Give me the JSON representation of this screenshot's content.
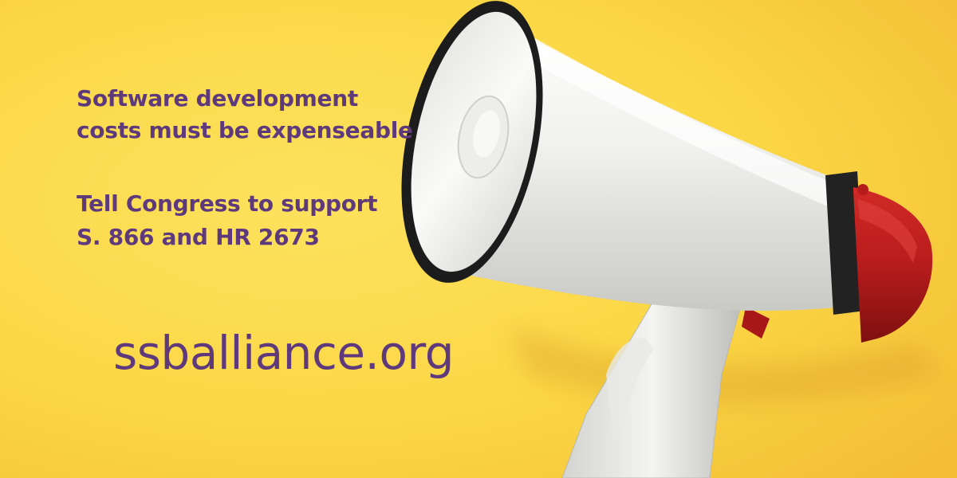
{
  "colors": {
    "background": "#FBD745",
    "background_light": "#FCE15C",
    "background_shadow": "#F1B934",
    "text": "#5E3A7C",
    "megaphone_body": "#F2F2F0",
    "megaphone_rim": "#1C1C1C",
    "megaphone_red": "#B71C1C"
  },
  "headline": {
    "line1": "Software development",
    "line2": "costs must be expenseable"
  },
  "cta": {
    "line1": "Tell Congress to support",
    "line2": "S. 866 and HR 2673"
  },
  "website": "ssballiance.org",
  "image": {
    "subject": "megaphone-icon"
  }
}
